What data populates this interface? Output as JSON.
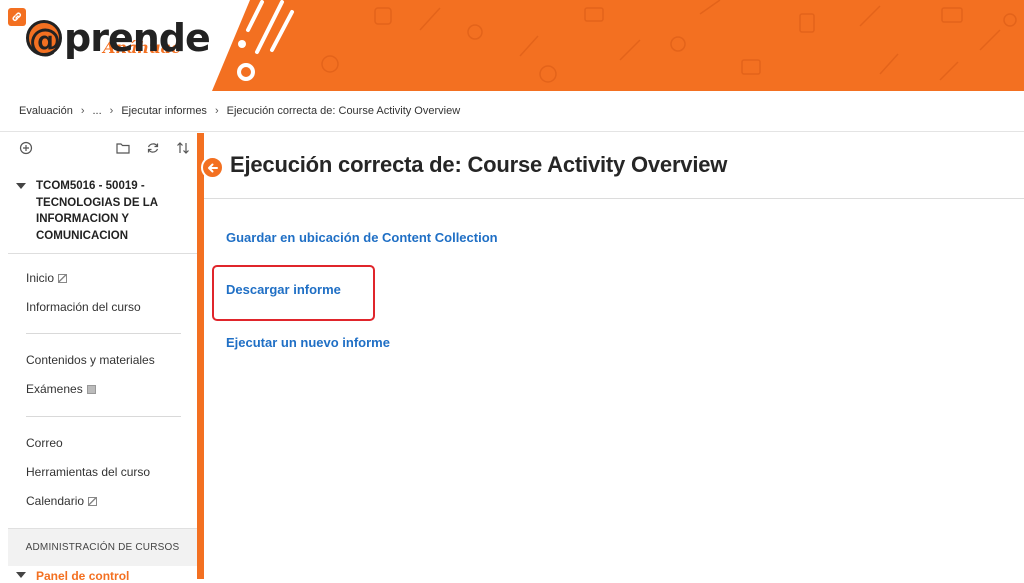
{
  "header": {
    "logo_text": "prende",
    "logo_at": "@",
    "logo_sub": "Anáhuac",
    "brand_color": "#f37021"
  },
  "breadcrumb": {
    "items": [
      "Evaluación",
      "...",
      "Ejecutar informes",
      "Ejecución correcta de: Course Activity Overview"
    ]
  },
  "sidebar": {
    "toolbar_icons": [
      "add-icon",
      "folder-icon",
      "refresh-icon",
      "sort-icon"
    ],
    "course_title": "TCOM5016 - 50019 - TECNOLOGIAS DE LA INFORMACION Y COMUNICACION",
    "menu": {
      "inicio": "Inicio",
      "info_curso": "Información del curso",
      "contenidos": "Contenidos y materiales",
      "examenes": "Exámenes",
      "correo": "Correo",
      "herramientas": "Herramientas del curso",
      "calendario": "Calendario"
    },
    "admin_label": "ADMINISTRACIÓN DE CURSOS",
    "panel_label": "Panel de control"
  },
  "main": {
    "title": "Ejecución correcta de: Course Activity Overview",
    "links": {
      "save": "Guardar en ubicación de Content Collection",
      "download": "Descargar informe",
      "new_report": "Ejecutar un nuevo informe"
    },
    "link_color": "#1f6fc5",
    "highlight_color": "#e0252b"
  }
}
